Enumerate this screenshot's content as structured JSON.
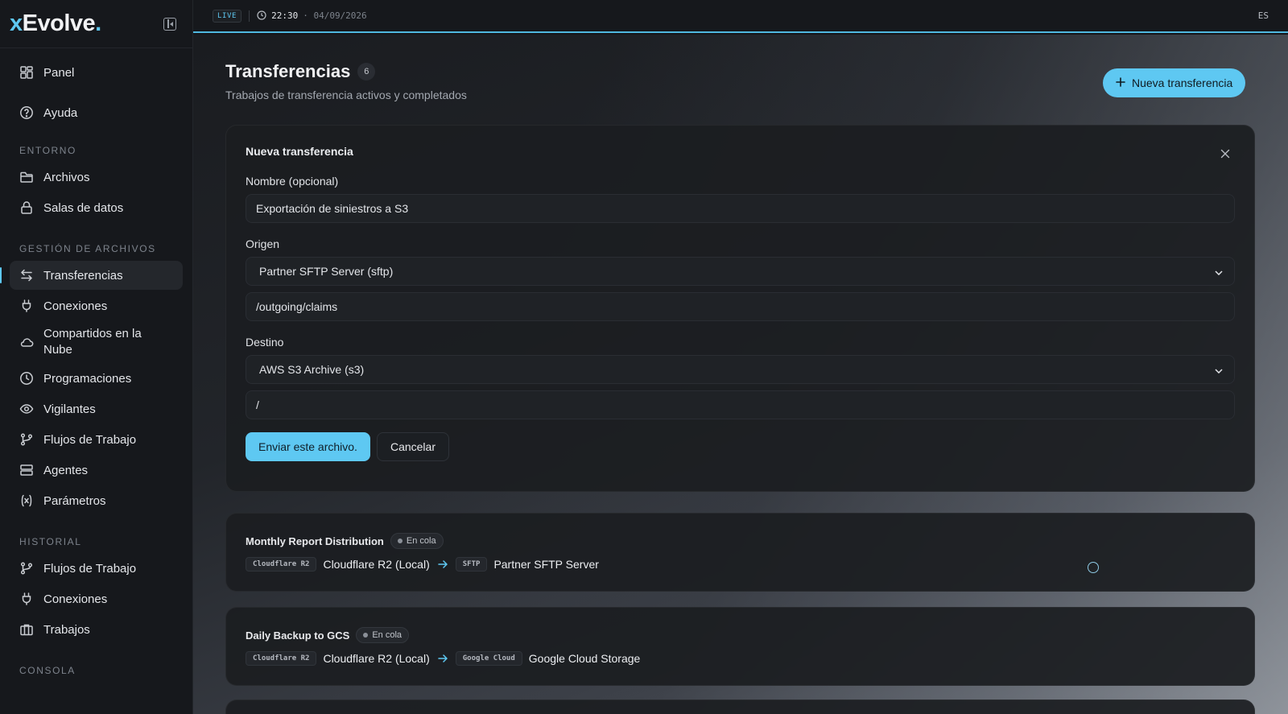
{
  "brand": {
    "prefix": "x",
    "name": "Evolve",
    "suffix": "."
  },
  "topbar": {
    "live": "LIVE",
    "time": "22:30",
    "date": "· 04/09/2026",
    "lang": "ES"
  },
  "sidebar": {
    "top": [
      {
        "label": "Panel",
        "icon": "grid-icon"
      },
      {
        "label": "Ayuda",
        "icon": "help-circle-icon"
      }
    ],
    "sections": [
      {
        "title": "ENTORNO",
        "items": [
          {
            "label": "Archivos",
            "icon": "folder-icon"
          },
          {
            "label": "Salas de datos",
            "icon": "lock-icon"
          }
        ]
      },
      {
        "title": "GESTIÓN DE ARCHIVOS",
        "items": [
          {
            "label": "Transferencias",
            "icon": "swap-arrows-icon",
            "active": true
          },
          {
            "label": "Conexiones",
            "icon": "plug-icon"
          },
          {
            "label": "Compartidos en la Nube",
            "icon": "cloud-icon"
          },
          {
            "label": "Programaciones",
            "icon": "clock-icon"
          },
          {
            "label": "Vigilantes",
            "icon": "eye-icon"
          },
          {
            "label": "Flujos de Trabajo",
            "icon": "branch-icon"
          },
          {
            "label": "Agentes",
            "icon": "server-icon"
          },
          {
            "label": "Parámetros",
            "icon": "variable-icon"
          }
        ]
      },
      {
        "title": "HISTORIAL",
        "items": [
          {
            "label": "Flujos de Trabajo",
            "icon": "branch-icon"
          },
          {
            "label": "Conexiones",
            "icon": "plug-icon"
          },
          {
            "label": "Trabajos",
            "icon": "briefcase-icon"
          }
        ]
      },
      {
        "title": "CONSOLA",
        "items": []
      }
    ]
  },
  "page": {
    "title": "Transferencias",
    "count": "6",
    "subtitle": "Trabajos de transferencia activos y completados",
    "new_button": "Nueva transferencia"
  },
  "form": {
    "title": "Nueva transferencia",
    "name_label": "Nombre (opcional)",
    "name_value": "Exportación de siniestros a S3",
    "origin_label": "Origen",
    "origin_select": "Partner SFTP Server (sftp)",
    "origin_path": "/outgoing/claims",
    "dest_label": "Destino",
    "dest_select": "AWS S3 Archive (s3)",
    "dest_path": "/",
    "submit": "Enviar este archivo.",
    "cancel": "Cancelar"
  },
  "transfers": [
    {
      "name": "Monthly Report Distribution",
      "status": "En cola",
      "source_tag": "Cloudflare R2",
      "source": "Cloudflare R2 (Local)",
      "dest_tag": "SFTP",
      "dest": "Partner SFTP Server"
    },
    {
      "name": "Daily Backup to GCS",
      "status": "En cola",
      "source_tag": "Cloudflare R2",
      "source": "Cloudflare R2 (Local)",
      "dest_tag": "Google Cloud",
      "dest": "Google Cloud Storage"
    }
  ],
  "colors": {
    "accent": "#5ec8f2",
    "background": "#15171b"
  }
}
